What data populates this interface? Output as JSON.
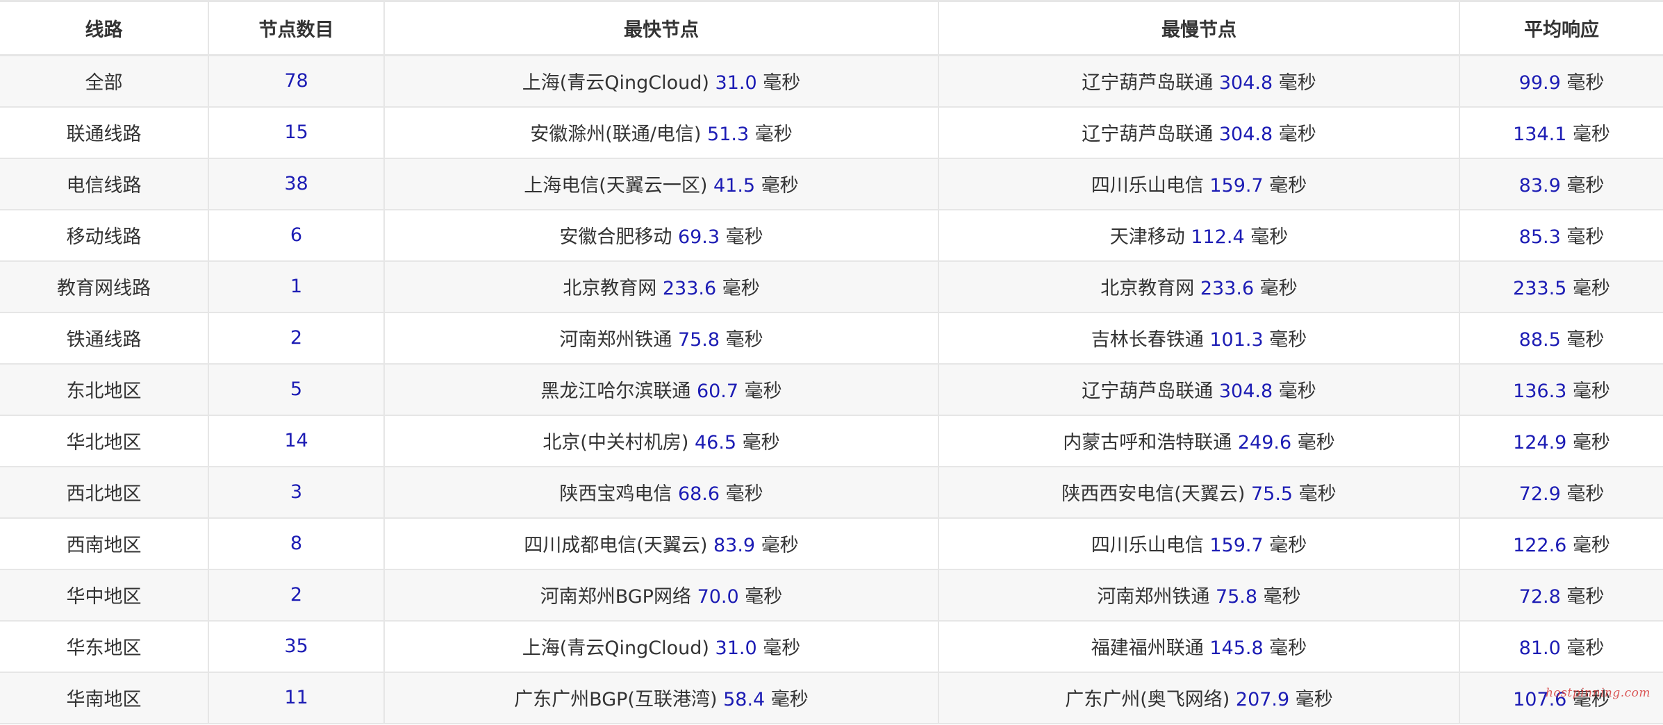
{
  "table": {
    "headers": [
      "线路",
      "节点数目",
      "最快节点",
      "最慢节点",
      "平均响应"
    ],
    "unit": "毫秒",
    "rows": [
      {
        "route": "全部",
        "count": "78",
        "fastest_node": "上海(青云QingCloud)",
        "fastest_ms": "31.0",
        "slowest_node": "辽宁葫芦岛联通",
        "slowest_ms": "304.8",
        "average_ms": "99.9"
      },
      {
        "route": "联通线路",
        "count": "15",
        "fastest_node": "安徽滁州(联通/电信)",
        "fastest_ms": "51.3",
        "slowest_node": "辽宁葫芦岛联通",
        "slowest_ms": "304.8",
        "average_ms": "134.1"
      },
      {
        "route": "电信线路",
        "count": "38",
        "fastest_node": "上海电信(天翼云一区)",
        "fastest_ms": "41.5",
        "slowest_node": "四川乐山电信",
        "slowest_ms": "159.7",
        "average_ms": "83.9"
      },
      {
        "route": "移动线路",
        "count": "6",
        "fastest_node": "安徽合肥移动",
        "fastest_ms": "69.3",
        "slowest_node": "天津移动",
        "slowest_ms": "112.4",
        "average_ms": "85.3"
      },
      {
        "route": "教育网线路",
        "count": "1",
        "fastest_node": "北京教育网",
        "fastest_ms": "233.6",
        "slowest_node": "北京教育网",
        "slowest_ms": "233.6",
        "average_ms": "233.5"
      },
      {
        "route": "铁通线路",
        "count": "2",
        "fastest_node": "河南郑州铁通",
        "fastest_ms": "75.8",
        "slowest_node": "吉林长春铁通",
        "slowest_ms": "101.3",
        "average_ms": "88.5"
      },
      {
        "route": "东北地区",
        "count": "5",
        "fastest_node": "黑龙江哈尔滨联通",
        "fastest_ms": "60.7",
        "slowest_node": "辽宁葫芦岛联通",
        "slowest_ms": "304.8",
        "average_ms": "136.3"
      },
      {
        "route": "华北地区",
        "count": "14",
        "fastest_node": "北京(中关村机房)",
        "fastest_ms": "46.5",
        "slowest_node": "内蒙古呼和浩特联通",
        "slowest_ms": "249.6",
        "average_ms": "124.9"
      },
      {
        "route": "西北地区",
        "count": "3",
        "fastest_node": "陕西宝鸡电信",
        "fastest_ms": "68.6",
        "slowest_node": "陕西西安电信(天翼云)",
        "slowest_ms": "75.5",
        "average_ms": "72.9"
      },
      {
        "route": "西南地区",
        "count": "8",
        "fastest_node": "四川成都电信(天翼云)",
        "fastest_ms": "83.9",
        "slowest_node": "四川乐山电信",
        "slowest_ms": "159.7",
        "average_ms": "122.6"
      },
      {
        "route": "华中地区",
        "count": "2",
        "fastest_node": "河南郑州BGP网络",
        "fastest_ms": "70.0",
        "slowest_node": "河南郑州铁通",
        "slowest_ms": "75.8",
        "average_ms": "72.8"
      },
      {
        "route": "华东地区",
        "count": "35",
        "fastest_node": "上海(青云QingCloud)",
        "fastest_ms": "31.0",
        "slowest_node": "福建福州联通",
        "slowest_ms": "145.8",
        "average_ms": "81.0"
      },
      {
        "route": "华南地区",
        "count": "11",
        "fastest_node": "广东广州BGP(互联港湾)",
        "fastest_ms": "58.4",
        "slowest_node": "广东广州(奥飞网络)",
        "slowest_ms": "207.9",
        "average_ms": "107.6"
      }
    ]
  },
  "watermark": "hostpinning.com",
  "colors": {
    "number": "#1c1cb4",
    "text": "#333333",
    "border": "#e6e6e6",
    "stripe": "#f7f7f7",
    "watermark": "#d63b3b"
  }
}
